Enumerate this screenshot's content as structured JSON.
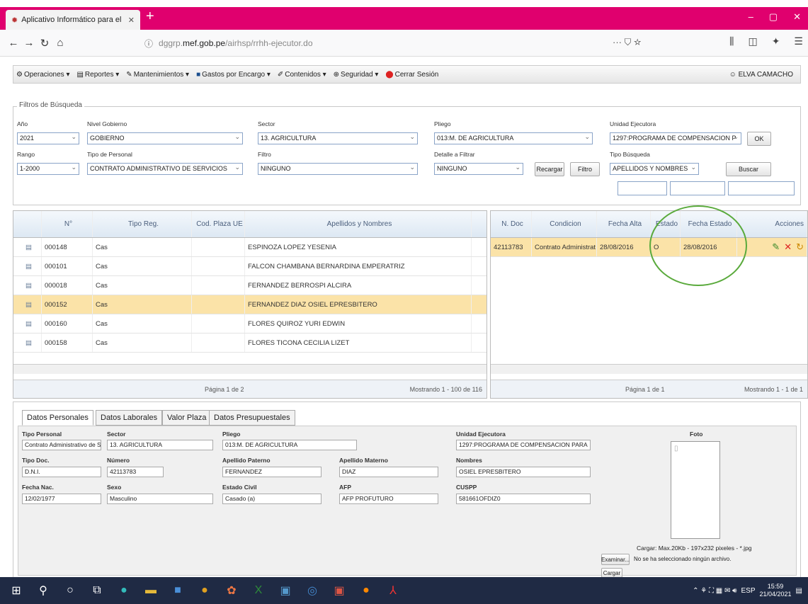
{
  "browser": {
    "tab_title": "Aplicativo Informático para el",
    "url_prefix": "dggrp.",
    "url_domain": "mef.gob.pe",
    "url_path": "/airhsp/rrhh-ejecutor.do",
    "page_actions": "··· ⛉ ☆"
  },
  "menu": {
    "items": [
      "Operaciones ▾",
      "Reportes ▾",
      "Mantenimientos ▾",
      "Gastos por Encargo ▾",
      "Contenidos ▾",
      "Seguridad ▾",
      "Cerrar Sesión"
    ],
    "user": "ELVA CAMACHO"
  },
  "filters": {
    "legend": "Filtros de Búsqueda",
    "anio_label": "Año",
    "anio": "2021",
    "nivel_label": "Nivel Gobierno",
    "nivel": "GOBIERNO",
    "sector_label": "Sector",
    "sector": "13. AGRICULTURA",
    "pliego_label": "Pliego",
    "pliego": "013:M. DE AGRICULTURA",
    "ue_label": "Unidad Ejecutora",
    "ue": "1297:PROGRAMA DE COMPENSACION P",
    "ok": "OK",
    "rango_label": "Rango",
    "rango": "1-2000",
    "tipo_personal_label": "Tipo de Personal",
    "tipo_personal": "CONTRATO ADMINISTRATIVO DE SERVICIOS",
    "filtro_label": "Filtro",
    "filtro": "NINGUNO",
    "detalle_label": "Detalle a Filtrar",
    "detalle": "NINGUNO",
    "recargar": "Recargar",
    "filtro_btn": "Filtro",
    "tipo_busqueda_label": "Tipo Búsqueda",
    "tipo_busqueda": "APELLIDOS Y NOMBRES",
    "buscar": "Buscar"
  },
  "left_grid": {
    "headers": [
      "N°",
      "Tipo Reg.",
      "Cod. Plaza UE",
      "Apellidos y Nombres"
    ],
    "rows": [
      {
        "n": "000148",
        "tipo": "Cas",
        "cod": "",
        "nombre": "ESPINOZA LOPEZ YESENIA"
      },
      {
        "n": "000101",
        "tipo": "Cas",
        "cod": "",
        "nombre": "FALCON CHAMBANA BERNARDINA EMPERATRIZ"
      },
      {
        "n": "000018",
        "tipo": "Cas",
        "cod": "",
        "nombre": "FERNANDEZ BERROSPI ALCIRA"
      },
      {
        "n": "000152",
        "tipo": "Cas",
        "cod": "",
        "nombre": "FERNANDEZ DIAZ OSIEL EPRESBITERO"
      },
      {
        "n": "000160",
        "tipo": "Cas",
        "cod": "",
        "nombre": "FLORES QUIROZ YURI EDWIN"
      },
      {
        "n": "000158",
        "tipo": "Cas",
        "cod": "",
        "nombre": "FLORES TICONA CECILIA LIZET"
      }
    ],
    "pager_page": "Página 1 de 2",
    "pager_info": "Mostrando 1 - 100 de 116"
  },
  "right_grid": {
    "headers": [
      "N. Doc",
      "Condicion",
      "Fecha Alta",
      "Estado",
      "Fecha Estado",
      "Acciones"
    ],
    "row": {
      "doc": "42113783",
      "cond": "Contrato Administrat",
      "alta": "28/08/2016",
      "estado": "O",
      "fecha_estado": "28/08/2016"
    },
    "pager_page": "Página 1 de 1",
    "pager_info": "Mostrando 1 - 1 de 1"
  },
  "details": {
    "tabs": [
      "Datos Personales",
      "Datos Laborales",
      "Valor Plaza",
      "Datos Presupuestales"
    ],
    "tipo_personal_label": "Tipo Personal",
    "tipo_personal": "Contrato Administrativo de S",
    "sector_label": "Sector",
    "sector": "13. AGRICULTURA",
    "pliego_label": "Pliego",
    "pliego": "013:M. DE AGRICULTURA",
    "ue_label": "Unidad Ejecutora",
    "ue": "1297:PROGRAMA DE COMPENSACION PARA",
    "foto_label": "Foto",
    "tipo_doc_label": "Tipo Doc.",
    "tipo_doc": "D.N.I.",
    "numero_label": "Número",
    "numero": "42113783",
    "ap_pat_label": "Apellido Paterno",
    "ap_pat": "FERNANDEZ",
    "ap_mat_label": "Apellido Materno",
    "ap_mat": "DIAZ",
    "nombres_label": "Nombres",
    "nombres": "OSIEL EPRESBITERO",
    "fnac_label": "Fecha Nac.",
    "fnac": "12/02/1977",
    "sexo_label": "Sexo",
    "sexo": "Masculino",
    "civil_label": "Estado Civil",
    "civil": "Casado (a)",
    "afp_label": "AFP",
    "afp": "AFP PROFUTURO",
    "cuspp_label": "CUSPP",
    "cuspp": "581661OFDIZ0",
    "cargar_info": "Cargar: Max.20Kb - 197x232 pixeles - *.jpg",
    "examinar": "Examinar...",
    "no_file": "No se ha seleccionado ningún archivo.",
    "cargar_btn": "Cargar"
  },
  "taskbar": {
    "lang": "ESP",
    "time": "15:59",
    "date": "21/04/2021"
  }
}
